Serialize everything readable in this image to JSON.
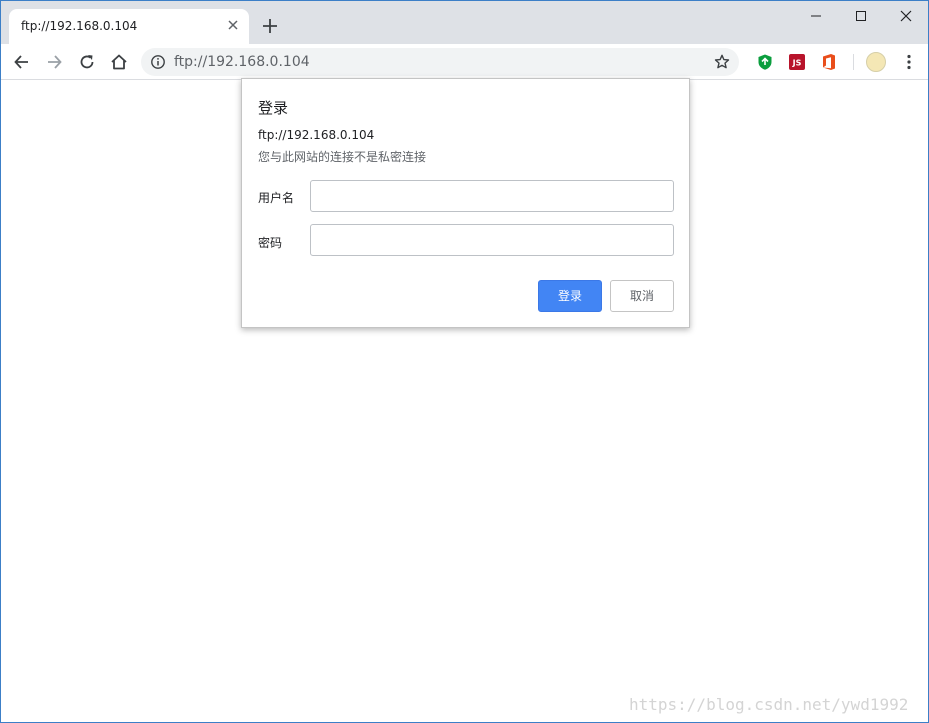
{
  "tab": {
    "title": "ftp://192.168.0.104"
  },
  "address_bar": {
    "url": "ftp://192.168.0.104"
  },
  "icons": {
    "tab_close": "close-icon",
    "new_tab": "plus-icon",
    "back": "arrow-left-icon",
    "forward": "arrow-right-icon",
    "reload": "reload-icon",
    "home": "home-icon",
    "site_info": "info-icon",
    "bookmark": "star-icon",
    "menu": "more-vertical-icon"
  },
  "extensions": {
    "js_badge": "JS",
    "colors": {
      "shield": "#0b9e3e",
      "js": "#b8142b",
      "office": "#e94e1b"
    }
  },
  "dialog": {
    "title": "登录",
    "origin": "ftp://192.168.0.104",
    "warning": "您与此网站的连接不是私密连接",
    "username_label": "用户名",
    "password_label": "密码",
    "username_value": "",
    "password_value": "",
    "login_button": "登录",
    "cancel_button": "取消"
  },
  "colors": {
    "accent": "#4285f4",
    "tabstrip": "#dee1e6",
    "omnibox": "#f1f3f4"
  },
  "watermark": "https://blog.csdn.net/ywd1992"
}
